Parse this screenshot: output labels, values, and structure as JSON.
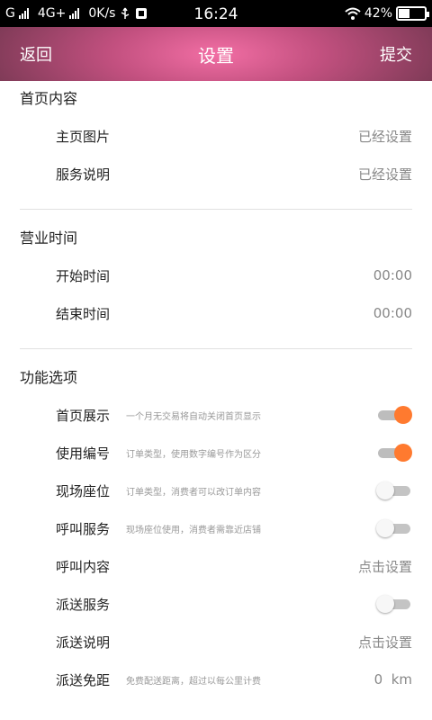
{
  "status_bar": {
    "carrier": "G",
    "network": "4G+",
    "speed": "0K/s",
    "time": "16:24",
    "battery": "42%"
  },
  "nav": {
    "back_label": "返回",
    "title": "设置",
    "submit_label": "提交"
  },
  "sections": {
    "home": {
      "title": "首页内容",
      "items": [
        {
          "label": "主页图片",
          "value": "已经设置"
        },
        {
          "label": "服务说明",
          "value": "已经设置"
        }
      ]
    },
    "hours": {
      "title": "营业时间",
      "items": [
        {
          "label": "开始时间",
          "value": "00:00"
        },
        {
          "label": "结束时间",
          "value": "00:00"
        }
      ]
    },
    "features": {
      "title": "功能选项",
      "items": [
        {
          "label": "首页展示",
          "hint": "一个月无交易将自动关闭首页显示",
          "toggle": "on"
        },
        {
          "label": "使用编号",
          "hint": "订单类型，使用数字编号作为区分",
          "toggle": "on"
        },
        {
          "label": "现场座位",
          "hint": "订单类型，消费者可以改订单内容",
          "toggle": "off"
        },
        {
          "label": "呼叫服务",
          "hint": "现场座位使用，消费者需靠近店铺",
          "toggle": "off"
        },
        {
          "label": "呼叫内容",
          "value": "点击设置"
        },
        {
          "label": "派送服务",
          "toggle": "off"
        },
        {
          "label": "派送说明",
          "value": "点击设置"
        },
        {
          "label": "派送免距",
          "hint": "免费配送距离，超过以每公里计费",
          "value": "0  km"
        }
      ]
    }
  },
  "colors": {
    "accent": "#ff7a2f",
    "nav_center": "#f26ea4",
    "nav_edge": "#7d3a56"
  }
}
